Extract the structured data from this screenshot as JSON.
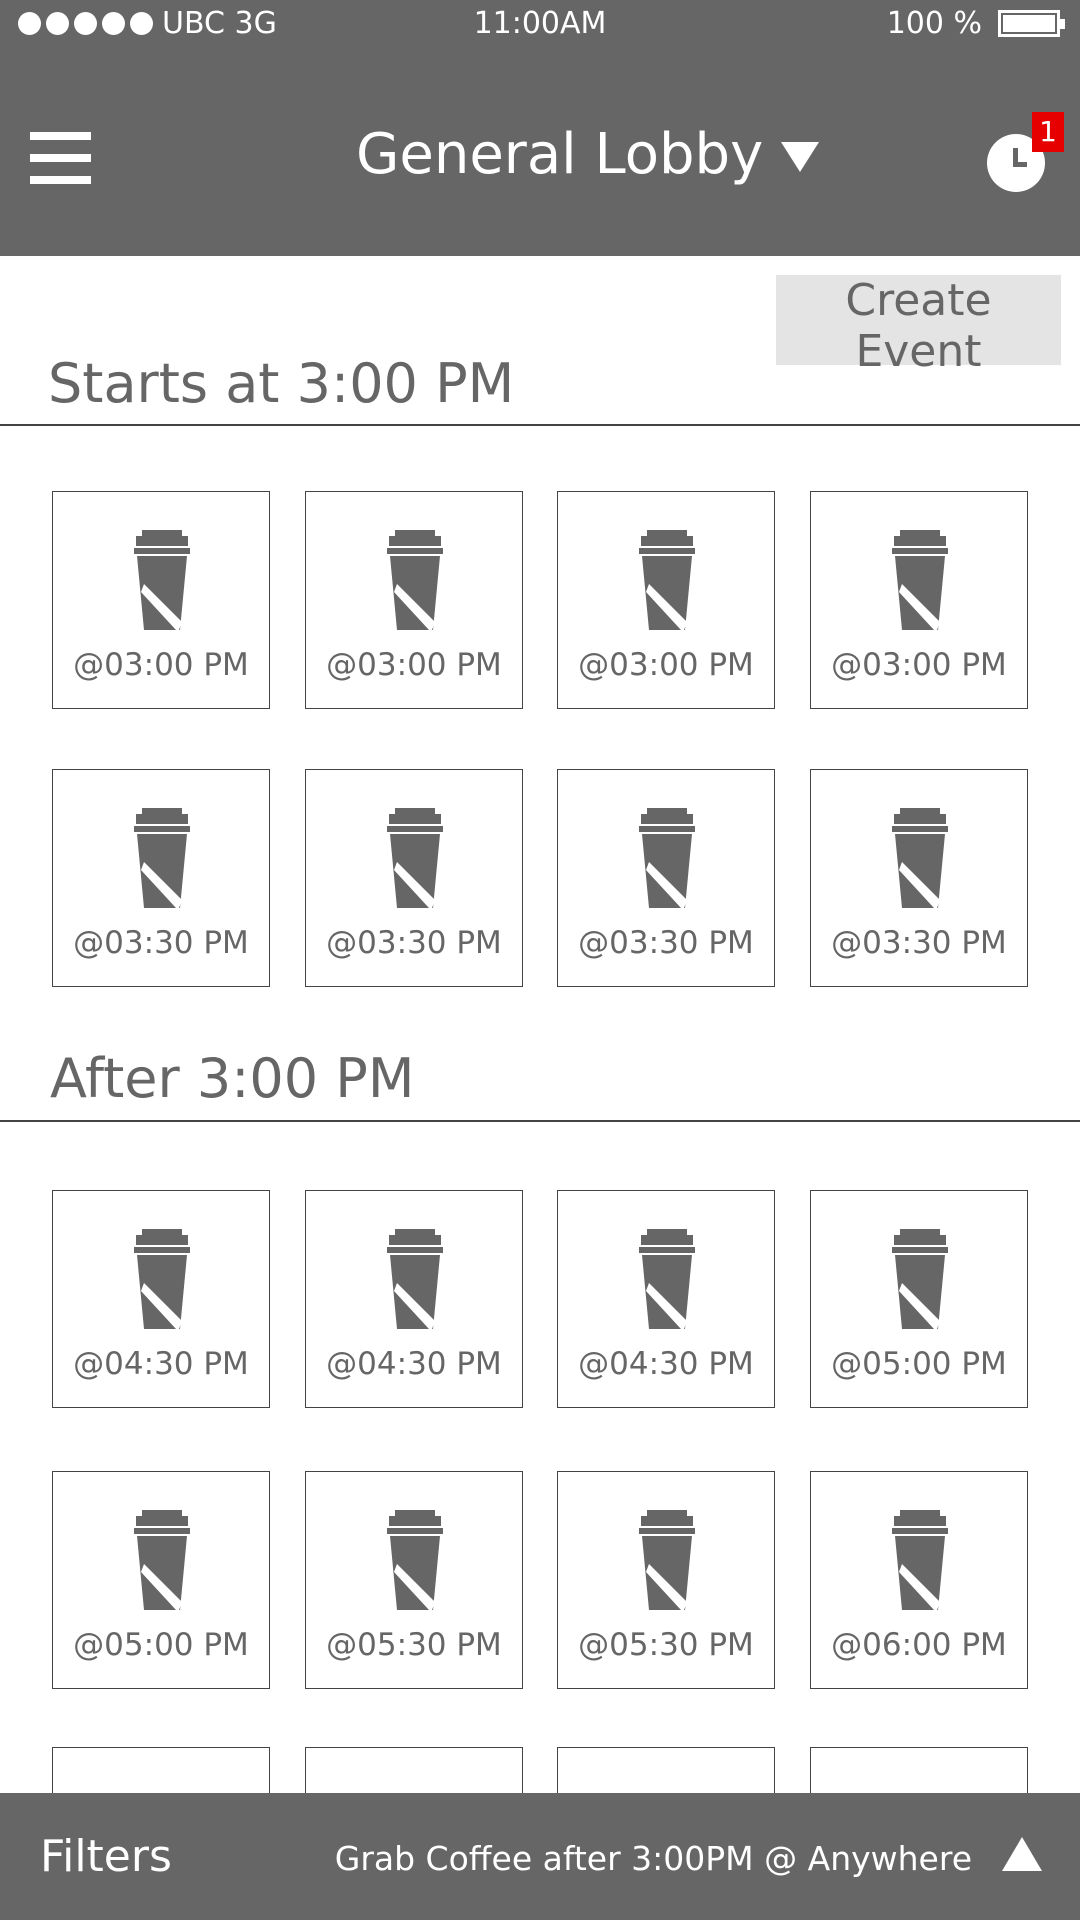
{
  "status_bar": {
    "carrier": "UBC  3G",
    "time": "11:00AM",
    "battery": "100 %",
    "battery_level": 1.0
  },
  "header": {
    "menu_icon": "hamburger-icon",
    "lobby": "General Lobby",
    "lobby_icon": "caret-down-icon",
    "history_icon": "clock-icon",
    "notification_count": "1"
  },
  "create_event_label": "Create Event",
  "sections": [
    {
      "title": "Starts at 3:00 PM",
      "events": [
        {
          "time": "@03:00 PM"
        },
        {
          "time": "@03:00 PM"
        },
        {
          "time": "@03:00 PM"
        },
        {
          "time": "@03:00 PM"
        },
        {
          "time": "@03:30 PM"
        },
        {
          "time": "@03:30 PM"
        },
        {
          "time": "@03:30 PM"
        },
        {
          "time": "@03:30 PM"
        }
      ]
    },
    {
      "title": "After 3:00 PM",
      "events": [
        {
          "time": "@04:30 PM"
        },
        {
          "time": "@04:30 PM"
        },
        {
          "time": "@04:30 PM"
        },
        {
          "time": "@05:00 PM"
        },
        {
          "time": "@05:00 PM"
        },
        {
          "time": "@05:30 PM"
        },
        {
          "time": "@05:30 PM"
        },
        {
          "time": "@06:00 PM"
        }
      ]
    }
  ],
  "event_icon": "coffee-cup-icon",
  "bottom_bar": {
    "filters_label": "Filters",
    "summary": "Grab Coffee after 3:00PM @ Anywhere",
    "expand_icon": "triangle-up-icon"
  },
  "colors": {
    "chrome": "#666666",
    "badge": "#e60000",
    "button_bg": "#e4e4e4",
    "background": "#ffffff"
  }
}
